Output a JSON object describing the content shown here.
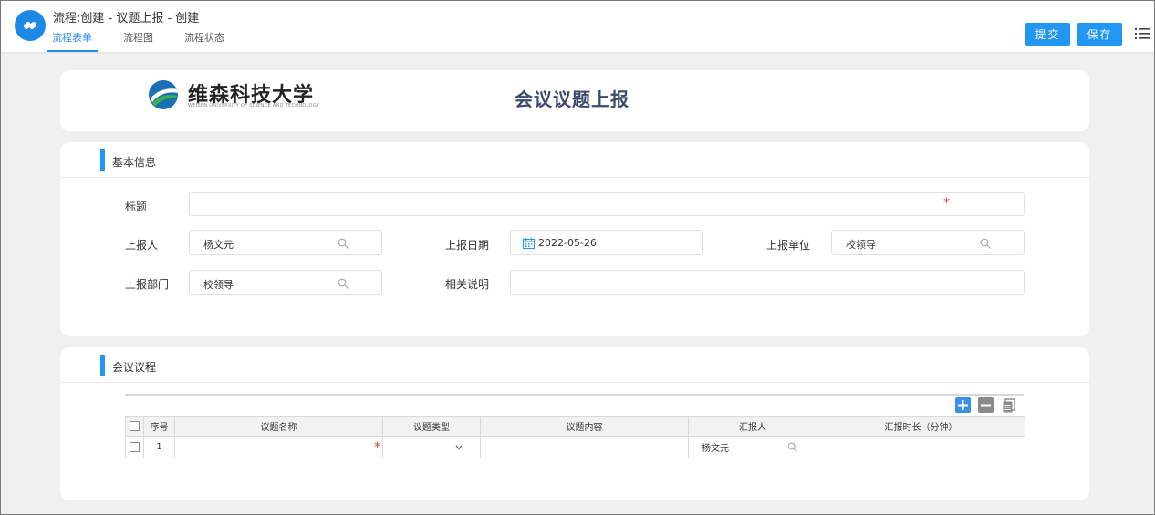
{
  "header": {
    "window_title": "流程:创建 - 议题上报 - 创建",
    "tabs": [
      {
        "label": "流程表单",
        "active": true
      },
      {
        "label": "流程图",
        "active": false
      },
      {
        "label": "流程状态",
        "active": false
      }
    ],
    "submit_label": "提交",
    "save_label": "保存",
    "accent_color": "#2196f3"
  },
  "form_header": {
    "school_name": "维森科技大学",
    "school_name_en": "WEISEN UNIVERSITY OF SCIENCE AND TECHNOLOGY",
    "form_title": "会议议题上报"
  },
  "basic_info": {
    "section_title": "基本信息",
    "title_label": "标题",
    "title_value": "",
    "reporter_label": "上报人",
    "reporter_value": "杨文元",
    "report_date_label": "上报日期",
    "report_date_value": "2022-05-26",
    "report_unit_label": "上报单位",
    "report_unit_value": "校领导",
    "report_dept_label": "上报部门",
    "report_dept_value": "校领导",
    "remark_label": "相关说明",
    "remark_value": ""
  },
  "agenda": {
    "section_title": "会议议程",
    "columns": [
      "序号",
      "议题名称",
      "议题类型",
      "议题内容",
      "汇报人",
      "汇报时长（分钟）"
    ],
    "rows": [
      {
        "index": "1",
        "name": "",
        "type": "",
        "content": "",
        "reporter": "杨文元",
        "duration": ""
      }
    ]
  }
}
